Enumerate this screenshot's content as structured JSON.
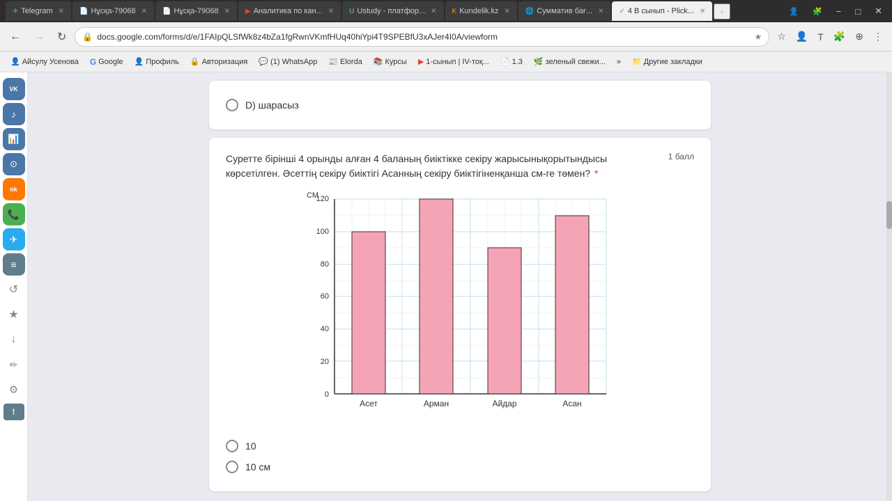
{
  "titlebar": {
    "tabs": [
      {
        "label": "Telegram",
        "icon_color": "#2AABEE",
        "icon_char": "✈",
        "active": false
      },
      {
        "label": "Нұсқа-79068",
        "icon_color": "#4285f4",
        "icon_char": "📄",
        "active": false
      },
      {
        "label": "Нұсқа-79068",
        "icon_color": "#ea4335",
        "icon_char": "📄",
        "active": false
      },
      {
        "label": "Аналитика по кан...",
        "icon_color": "#ea4335",
        "icon_char": "▶",
        "active": false
      },
      {
        "label": "Ustudy - платфор...",
        "icon_color": "#4caf50",
        "icon_char": "U",
        "active": false
      },
      {
        "label": "Kundelik.kz",
        "icon_color": "#ff9800",
        "icon_char": "K",
        "active": false
      },
      {
        "label": "Сумматив бағ...",
        "icon_color": "#4285f4",
        "icon_char": "🌐",
        "active": false
      },
      {
        "label": "4 В сынып - Plick...",
        "icon_color": "#4caf50",
        "icon_char": "✓",
        "active": true
      }
    ],
    "controls": [
      "−",
      "□",
      "✕"
    ]
  },
  "navbar": {
    "back_disabled": false,
    "forward_disabled": true,
    "url": "docs.google.com/forms/d/e/1FAIpQLSfWk8z4bZa1fgRwnVKmfHUq40hiYpi4T9SPEBfU3xAJer4I0A/viewform"
  },
  "bookmarks": [
    {
      "label": "Айсулу Усенова",
      "icon": "👤"
    },
    {
      "label": "Google",
      "icon": "G"
    },
    {
      "label": "Профиль",
      "icon": "👤"
    },
    {
      "label": "Авторизация",
      "icon": "🔒"
    },
    {
      "label": "(1) WhatsApp",
      "icon": "💬"
    },
    {
      "label": "Elorda",
      "icon": "📰"
    },
    {
      "label": "Курсы",
      "icon": "📚"
    },
    {
      "label": "1-сынып | IV-тоқ...",
      "icon": "▶"
    },
    {
      "label": "1.3",
      "icon": "📄"
    },
    {
      "label": "зеленый свежи...",
      "icon": "🌿"
    },
    {
      "label": "»",
      "icon": ""
    },
    {
      "label": "Другие закладки",
      "icon": "📁"
    }
  ],
  "sidebar_apps": [
    {
      "label": "VK",
      "bg": "#4a76a8",
      "char": "VK"
    },
    {
      "label": "Music",
      "bg": "#4a76a8",
      "char": "♪"
    },
    {
      "label": "Charts",
      "bg": "#4a76a8",
      "char": "📊"
    },
    {
      "label": "VK Apps",
      "bg": "#4a76a8",
      "char": "⊙"
    },
    {
      "label": "OK",
      "bg": "#ff7700",
      "char": "ok"
    },
    {
      "label": "Phone",
      "bg": "#4caf50",
      "char": "📞"
    },
    {
      "label": "Telegram",
      "bg": "#2AABEE",
      "char": "✈"
    },
    {
      "label": "List",
      "bg": "#607d8b",
      "char": "≡"
    },
    {
      "label": "Refresh",
      "bg": "#9e9e9e",
      "char": "↺"
    },
    {
      "label": "Star",
      "bg": "#9e9e9e",
      "char": "★"
    },
    {
      "label": "Download",
      "bg": "#9e9e9e",
      "char": "↓"
    },
    {
      "label": "Edit",
      "bg": "#9e9e9e",
      "char": "✏"
    },
    {
      "label": "Settings",
      "bg": "#9e9e9e",
      "char": "⚙"
    },
    {
      "label": "Alert",
      "bg": "#607d8b",
      "char": "!"
    }
  ],
  "form": {
    "partial_option": "D) шарасыз",
    "question": {
      "text": "Суретте бірінші 4 орынды алған 4 баланың биіктікке секіру жарысынықорытындысы көрсетілген. Әсеттің секіру биіктігі Асанның секіру биіктігіненқанша см-ге төмен?",
      "required": true,
      "points": "1 балл",
      "chart": {
        "y_label": "СМ",
        "y_max": 120,
        "y_min": 0,
        "y_step": 20,
        "bars": [
          {
            "label": "Асет",
            "value": 100
          },
          {
            "label": "Арман",
            "value": 120
          },
          {
            "label": "Айдар",
            "value": 90
          },
          {
            "label": "Асан",
            "value": 110
          }
        ]
      },
      "options": [
        {
          "label": "10",
          "value": "10"
        },
        {
          "label": "10 см",
          "value": "10cm"
        }
      ]
    }
  }
}
